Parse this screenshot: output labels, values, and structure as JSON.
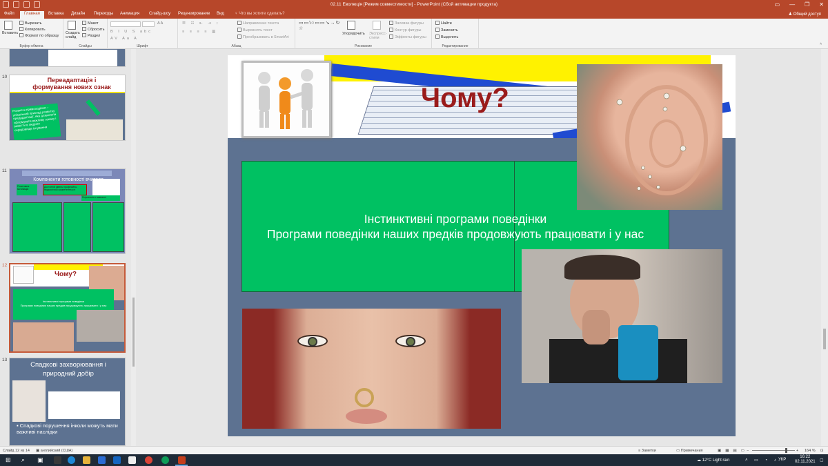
{
  "window": {
    "title": "02.11 Еволюція [Режим совместимости] - PowerPoint (Сбой активации продукта)",
    "minimize_icon": "minimize-icon",
    "maximize_icon": "restore-icon",
    "close_icon": "close-icon"
  },
  "tabs": {
    "items": [
      "Файл",
      "Главная",
      "Вставка",
      "Дизайн",
      "Переходы",
      "Анимация",
      "Слайд-шоу",
      "Рецензирование",
      "Вид"
    ],
    "active": "Главная",
    "tell_me": "Что вы хотите сделать?",
    "share": "Общий доступ"
  },
  "ribbon": {
    "clipboard": {
      "paste": "Вставить",
      "cut": "Вырезать",
      "copy": "Копировать",
      "format_painter": "Формат по образцу",
      "group": "Буфер обмена"
    },
    "slides": {
      "new_slide": "Создать слайд",
      "layout": "Макет",
      "reset": "Сбросить",
      "section": "Раздел",
      "group": "Слайды"
    },
    "font": {
      "group": "Шрифт"
    },
    "paragraph": {
      "text_direction": "Направление текста",
      "align_text": "Выровнять текст",
      "smartart": "Преобразовать в SmartArt",
      "group": "Абзац"
    },
    "drawing": {
      "arrange": "Упорядочить",
      "quick_styles": "Экспресс-стили",
      "fill": "Заливка фигуры",
      "outline": "Контур фигуры",
      "effects": "Эффекты фигуры",
      "group": "Рисование"
    },
    "editing": {
      "find": "Найти",
      "replace": "Заменить",
      "select": "Выделить",
      "group": "Редактирование"
    }
  },
  "thumbnails": [
    {
      "number": "10",
      "title": "Переадаптація і формування нових ознак",
      "body": "Розвиток прямоходіння – унікальний приклад розвитку предадаптації, яка дозволила сформувати важливу ознаку і вивести в людини середовище існування"
    },
    {
      "number": "11",
      "title": "Компоненти готовності вчителя",
      "labels": [
        "Позитивна мотивація",
        "Достатній рівень професійно-педагогічної компетентності",
        "Рефлексія в навчанні"
      ]
    },
    {
      "number": "12",
      "title": "Чому?",
      "line1": "Інстинктивні програми поведінки",
      "line2": "Програми поведінки наших предків продовжують працювати і у нас"
    },
    {
      "number": "13",
      "title": "Спадкові захворювання і природний добір",
      "bullet": "Спадкові порушення інколи можуть мати важливі наслідки"
    }
  ],
  "slide": {
    "title": "Чому?",
    "line1": "Інстинктивні програми поведінки",
    "line2": "Програми поведінки наших предків продовжують працювати і у нас"
  },
  "statusbar": {
    "slide_info": "Слайд 12 из 14",
    "language": "английский (США)",
    "notes": "Заметки",
    "comments": "Примечания",
    "zoom": "164 %"
  },
  "taskbar": {
    "weather": "12°C  Light rain",
    "lang": "УКР",
    "time": "16:22",
    "date": "02.11.2021"
  }
}
